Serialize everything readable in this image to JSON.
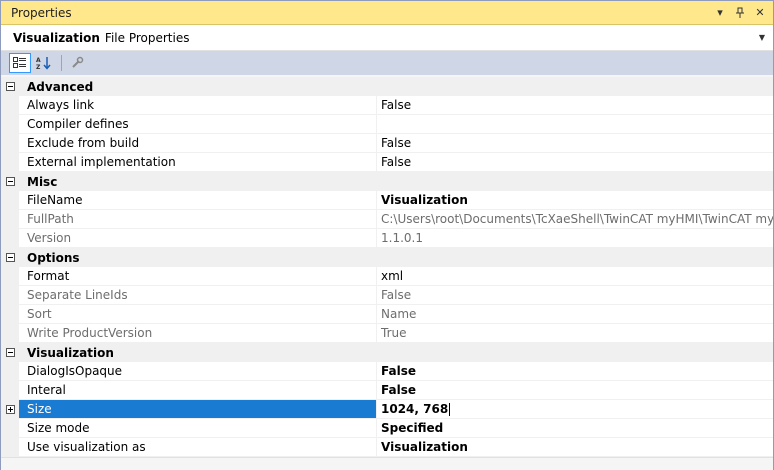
{
  "window": {
    "title": "Properties"
  },
  "object": {
    "name": "Visualization",
    "type": "File Properties"
  },
  "toolbar": {
    "icons": [
      "categorized-icon",
      "alphabetical-icon",
      "property-pages-icon"
    ]
  },
  "categories": [
    {
      "label": "Advanced",
      "rows": [
        {
          "name": "Always link",
          "value": "False",
          "readonly": false,
          "bold": false
        },
        {
          "name": "Compiler defines",
          "value": "",
          "readonly": false,
          "bold": false
        },
        {
          "name": "Exclude from build",
          "value": "False",
          "readonly": false,
          "bold": false
        },
        {
          "name": "External implementation",
          "value": "False",
          "readonly": false,
          "bold": false
        }
      ]
    },
    {
      "label": "Misc",
      "rows": [
        {
          "name": "FileName",
          "value": "Visualization",
          "readonly": false,
          "bold": true
        },
        {
          "name": "FullPath",
          "value": "C:\\Users\\root\\Documents\\TcXaeShell\\TwinCAT myHMI\\TwinCAT myHM",
          "readonly": true,
          "bold": false
        },
        {
          "name": "Version",
          "value": "1.1.0.1",
          "readonly": true,
          "bold": false
        }
      ]
    },
    {
      "label": "Options",
      "rows": [
        {
          "name": "Format",
          "value": "xml",
          "readonly": false,
          "bold": false
        },
        {
          "name": "Separate LineIds",
          "value": "False",
          "readonly": true,
          "bold": false
        },
        {
          "name": "Sort",
          "value": "Name",
          "readonly": true,
          "bold": false
        },
        {
          "name": "Write ProductVersion",
          "value": "True",
          "readonly": true,
          "bold": false
        }
      ]
    },
    {
      "label": "Visualization",
      "rows": [
        {
          "name": "DialogIsOpaque",
          "value": "False",
          "readonly": false,
          "bold": true
        },
        {
          "name": "Interal",
          "value": "False",
          "readonly": false,
          "bold": true
        },
        {
          "name": "Size",
          "value": "1024, 768",
          "readonly": false,
          "bold": true,
          "selected": true,
          "expandable": true
        },
        {
          "name": "Size mode",
          "value": "Specified",
          "readonly": false,
          "bold": true
        },
        {
          "name": "Use visualization as",
          "value": "Visualization",
          "readonly": false,
          "bold": true
        }
      ]
    }
  ],
  "colors": {
    "titlebar": "#ffe88c",
    "selection": "#1a7bd3",
    "toolbar": "#cfd6e5"
  }
}
